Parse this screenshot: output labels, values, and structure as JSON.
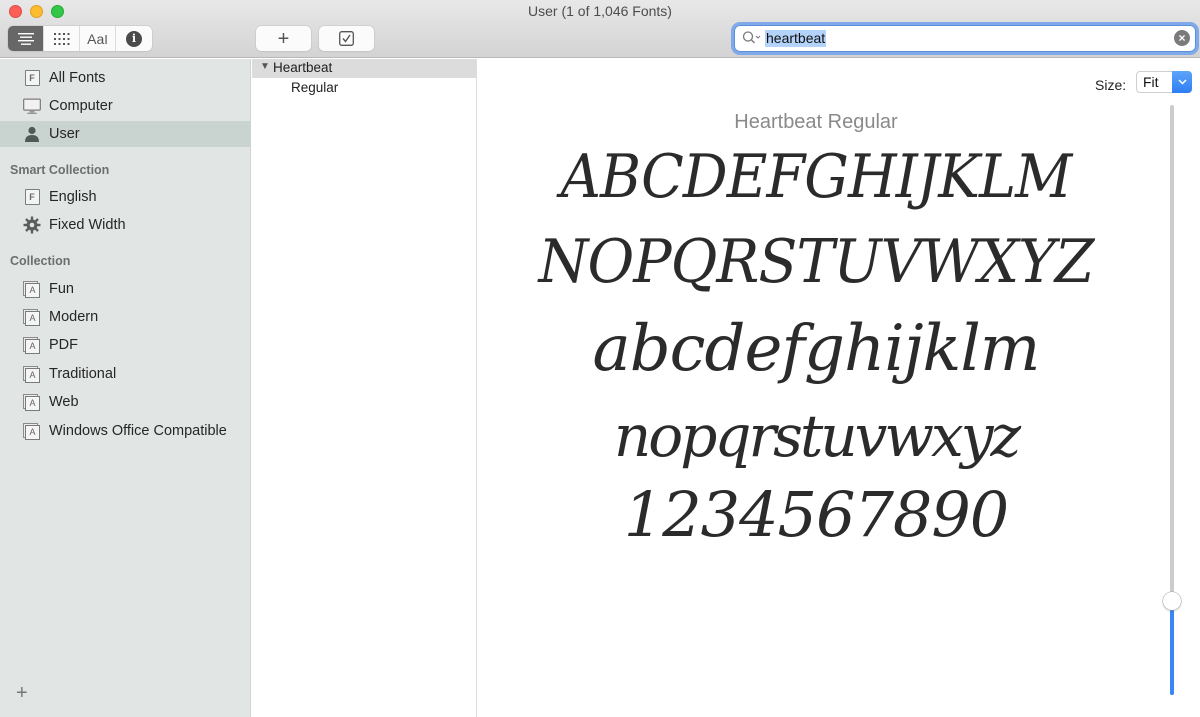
{
  "window": {
    "title": "User (1 of 1,046 Fonts)"
  },
  "toolbar": {
    "view_modes": [
      {
        "name": "sample-view",
        "icon": "list-lines-icon",
        "active": true
      },
      {
        "name": "glyph-grid",
        "icon": "grid-dots-icon",
        "active": false
      },
      {
        "name": "custom-text",
        "icon": "text-cursor-icon",
        "label": "Aa",
        "active": false
      },
      {
        "name": "info",
        "icon": "info-icon",
        "label": "i",
        "active": false
      }
    ],
    "add_label": "+",
    "validate_icon": "checkbox-icon"
  },
  "search": {
    "query": "heartbeat",
    "clear_icon": "×"
  },
  "sidebar": {
    "library_items": [
      {
        "label": "All Fonts",
        "icon": "font-file-icon",
        "glyph": "F",
        "selected": false
      },
      {
        "label": "Computer",
        "icon": "computer-icon",
        "selected": false
      },
      {
        "label": "User",
        "icon": "user-icon",
        "selected": true
      }
    ],
    "smart_heading": "Smart Collection",
    "smart_items": [
      {
        "label": "English",
        "icon": "font-file-icon",
        "glyph": "F"
      },
      {
        "label": "Fixed Width",
        "icon": "gear-icon"
      }
    ],
    "collection_heading": "Collection",
    "collection_items": [
      {
        "label": "Fun",
        "glyph": "A"
      },
      {
        "label": "Modern",
        "glyph": "A"
      },
      {
        "label": "PDF",
        "glyph": "A"
      },
      {
        "label": "Traditional",
        "glyph": "A"
      },
      {
        "label": "Web",
        "glyph": "A"
      },
      {
        "label": "Windows Office Compatible",
        "glyph": "A"
      }
    ],
    "add_label": "+"
  },
  "font_list": {
    "family": "Heartbeat",
    "expanded_glyph": "▼",
    "faces": [
      "Regular"
    ]
  },
  "preview": {
    "size_label": "Size:",
    "size_value": "Fit",
    "title": "Heartbeat Regular",
    "lines": [
      "ABCDEFGHIJKLM",
      "NOPQRSTUVWXYZ",
      "abcdefghijklm",
      "nopqrstuvwxyz",
      "1234567890"
    ],
    "size_slider_fraction": 0.16
  },
  "colors": {
    "accent": "#3b86f7",
    "sidebar_bg": "#e1e6e4",
    "sidebar_selected": "#c9d3cf",
    "search_highlight": "#b4d3fa"
  }
}
